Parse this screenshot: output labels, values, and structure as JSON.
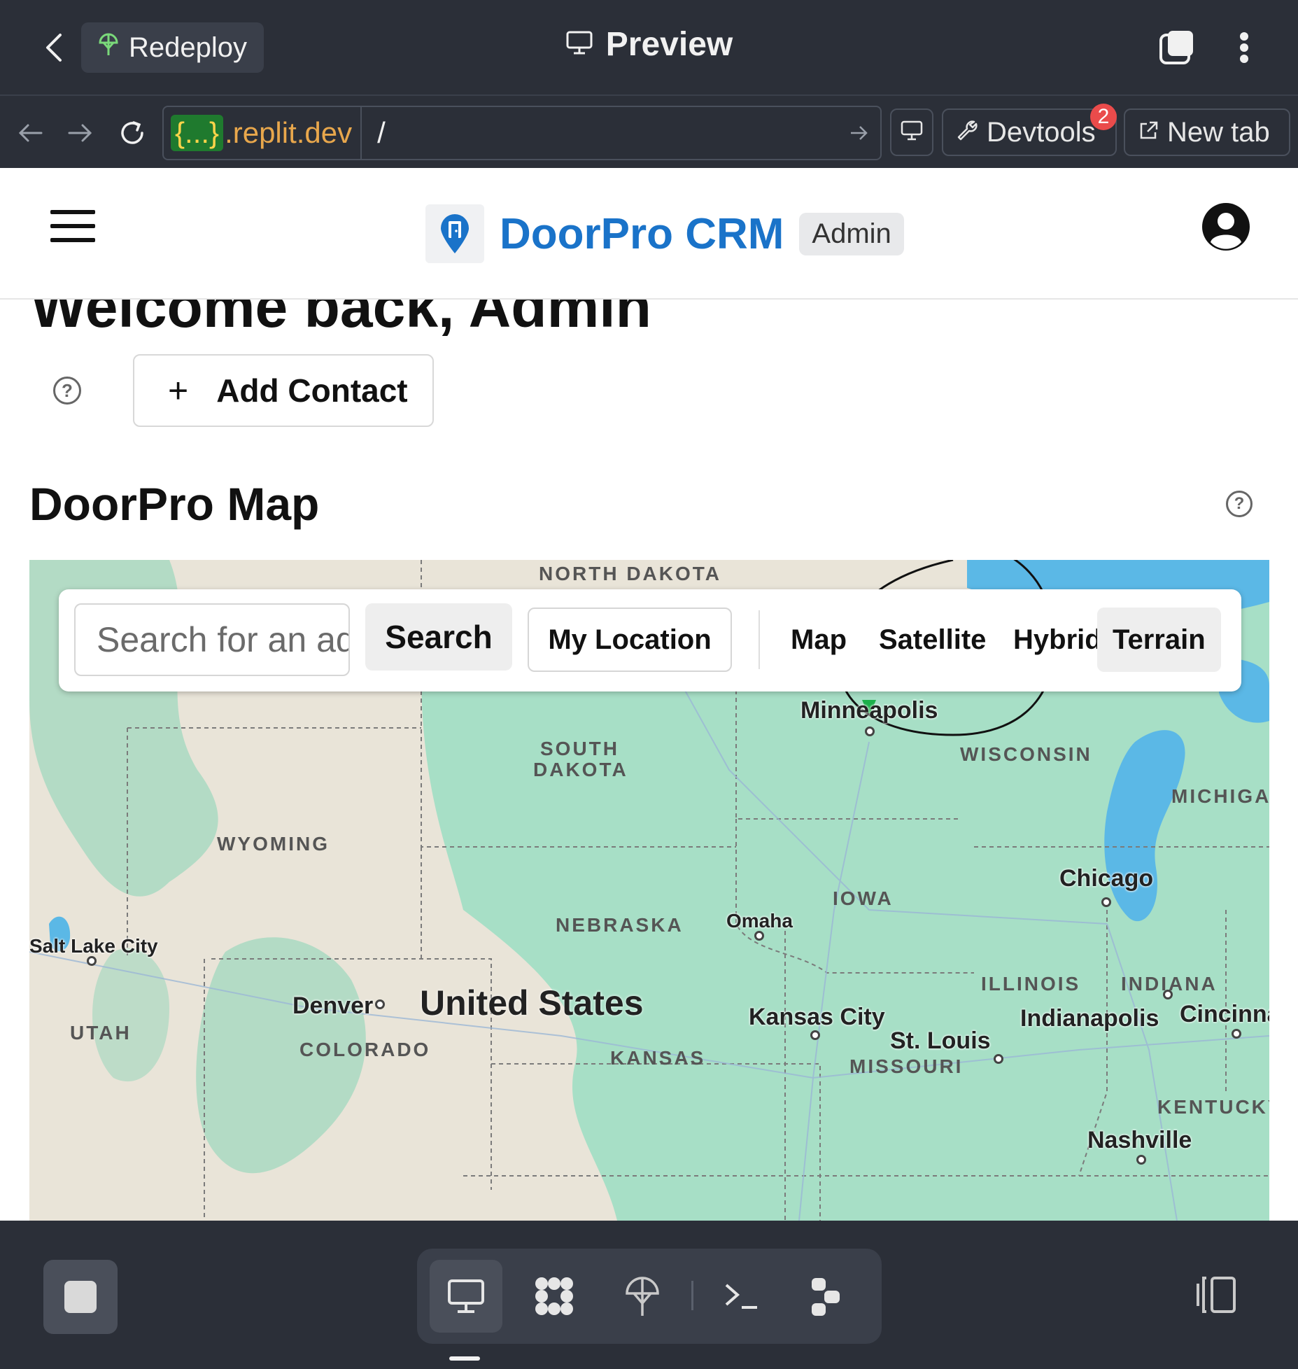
{
  "replit": {
    "redeploy_label": "Redeploy",
    "title": "Preview",
    "url_host_braces": "{...}",
    "url_host_suffix": ".replit.dev",
    "url_path": "/",
    "devtools_label": "Devtools",
    "devtools_badge": "2",
    "new_tab_label": "New tab"
  },
  "app": {
    "brand_name": "DoorPro CRM",
    "role_chip": "Admin",
    "welcome_text": "Welcome back, Admin",
    "add_contact_label": "Add Contact",
    "map_title": "DoorPro Map"
  },
  "map": {
    "search_placeholder": "Search for an address...",
    "search_button": "Search",
    "my_location_button": "My Location",
    "map_types": [
      "Map",
      "Satellite",
      "Hybrid",
      "Terrain"
    ],
    "active_map_type": "Terrain",
    "state_labels": {
      "north_dakota": "NORTH DAKOTA",
      "south_dakota_1": "SOUTH",
      "south_dakota_2": "DAKOTA",
      "wyoming": "WYOMING",
      "nebraska": "NEBRASKA",
      "iowa": "IOWA",
      "wisconsin": "WISCONSIN",
      "michigan": "MICHIGA",
      "illinois": "ILLINOIS",
      "indiana": "INDIANA",
      "utah": "UTAH",
      "colorado": "COLORADO",
      "kansas": "KANSAS",
      "missouri": "MISSOURI",
      "kentucky": "KENTUCKY"
    },
    "city_labels": {
      "minneapolis": "Minneapolis",
      "chicago": "Chicago",
      "omaha": "Omaha",
      "salt_lake_city": "Salt Lake City",
      "denver": "Denver",
      "kansas_city": "Kansas City",
      "st_louis": "St. Louis",
      "indianapolis": "Indianapolis",
      "cincinnati": "Cincinna",
      "nashville": "Nashville"
    },
    "country_label": "United States"
  },
  "colors": {
    "brand": "#1a73c9",
    "chrome_bg": "#2b2f38",
    "badge": "#ea4b4b",
    "water": "#5bb8e6",
    "land": "#e9e4d8",
    "vegetation": "#a7dfc6"
  }
}
